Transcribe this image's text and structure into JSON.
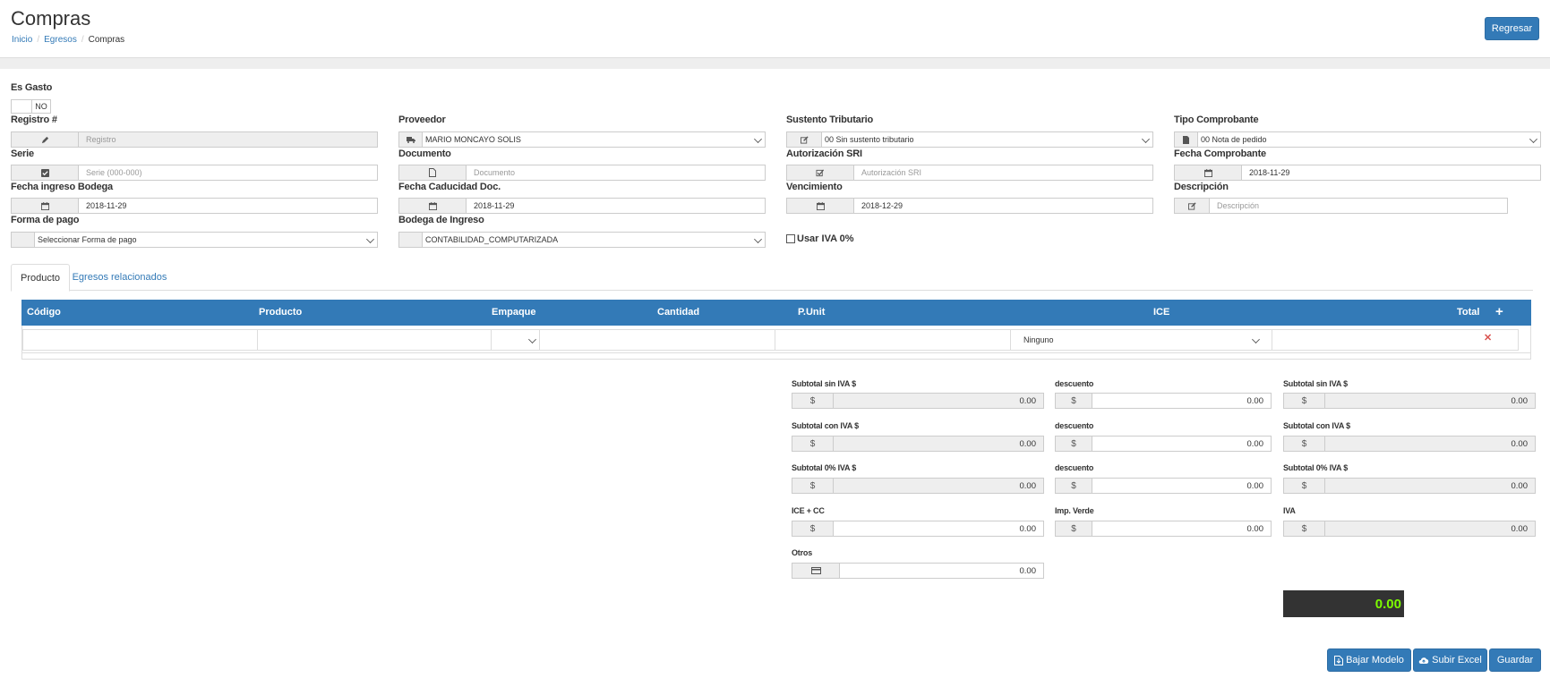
{
  "header": {
    "title": "Compras",
    "breadcrumb": [
      "Inicio",
      "Egresos",
      "Compras"
    ],
    "back_label": "Regresar"
  },
  "form": {
    "es_gasto_label": "Es Gasto",
    "es_gasto_value": "NO",
    "registro": {
      "label": "Registro #",
      "placeholder": "Registro",
      "icon": "pencil-icon"
    },
    "proveedor": {
      "label": "Proveedor",
      "value": "MARIO MONCAYO SOLIS",
      "icon": "truck-icon"
    },
    "sustento": {
      "label": "Sustento Tributario",
      "value": "00 Sin sustento tributario",
      "icon": "edit-icon"
    },
    "tipo_comprobante": {
      "label": "Tipo Comprobante",
      "value": "00 Nota de pedido",
      "icon": "file-icon"
    },
    "serie": {
      "label": "Serie",
      "placeholder": "Serie (000-000)",
      "icon": "check-square-icon"
    },
    "documento": {
      "label": "Documento",
      "placeholder": "Documento",
      "icon": "file-outline-icon"
    },
    "autorizacion": {
      "label": "Autorización SRI",
      "placeholder": "Autorización SRI",
      "icon": "check-edit-icon"
    },
    "fecha_comprobante": {
      "label": "Fecha Comprobante",
      "value": "2018-11-29",
      "icon": "calendar-icon"
    },
    "fecha_ingreso": {
      "label": "Fecha ingreso Bodega",
      "value": "2018-11-29",
      "icon": "calendar-icon"
    },
    "fecha_caducidad": {
      "label": "Fecha Caducidad Doc.",
      "value": "2018-11-29",
      "icon": "calendar-icon"
    },
    "vencimiento": {
      "label": "Vencimiento",
      "value": "2018-12-29",
      "icon": "calendar-icon"
    },
    "descripcion": {
      "label": "Descripción",
      "placeholder": "Descripción",
      "icon": "edit-icon"
    },
    "forma_pago": {
      "label": "Forma de pago",
      "value": "Seleccionar Forma de pago"
    },
    "bodega": {
      "label": "Bodega de Ingreso",
      "value": "CONTABILIDAD_COMPUTARIZADA"
    },
    "iva0_label": "Usar IVA 0%"
  },
  "tabs": [
    "Producto",
    "Egresos relacionados"
  ],
  "table": {
    "columns": [
      "Código",
      "Producto",
      "Empaque",
      "Cantidad",
      "P.Unit",
      "ICE",
      "Total"
    ],
    "row": {
      "ice": "Ninguno"
    }
  },
  "totals": {
    "currency": "$",
    "col1": [
      {
        "label": "Subtotal sin IVA $",
        "value": "0.00",
        "readonly": true
      },
      {
        "label": "Subtotal con IVA $",
        "value": "0.00",
        "readonly": true
      },
      {
        "label": "Subtotal 0% IVA $",
        "value": "0.00",
        "readonly": true
      },
      {
        "label": "ICE + CC",
        "value": "0.00",
        "readonly": false
      }
    ],
    "col2": [
      {
        "label": "descuento",
        "value": "0.00"
      },
      {
        "label": "descuento",
        "value": "0.00"
      },
      {
        "label": "descuento",
        "value": "0.00"
      },
      {
        "label": "Imp. Verde",
        "value": "0.00"
      }
    ],
    "col3": [
      {
        "label": "Subtotal sin IVA $",
        "value": "0.00"
      },
      {
        "label": "Subtotal con IVA $",
        "value": "0.00"
      },
      {
        "label": "Subtotal 0% IVA $",
        "value": "0.00"
      },
      {
        "label": "IVA",
        "value": "0.00"
      }
    ],
    "otros": {
      "label": "Otros",
      "value": "0.00",
      "icon": "credit-card-icon"
    },
    "grand_total": "0.00"
  },
  "actions": {
    "bajar_modelo": "Bajar Modelo",
    "subir_excel": "Subir Excel",
    "guardar": "Guardar"
  },
  "colors": {
    "primary": "#337ab7",
    "total_bg": "#333333",
    "total_fg": "#7cfc00",
    "delete": "#d9534f"
  }
}
